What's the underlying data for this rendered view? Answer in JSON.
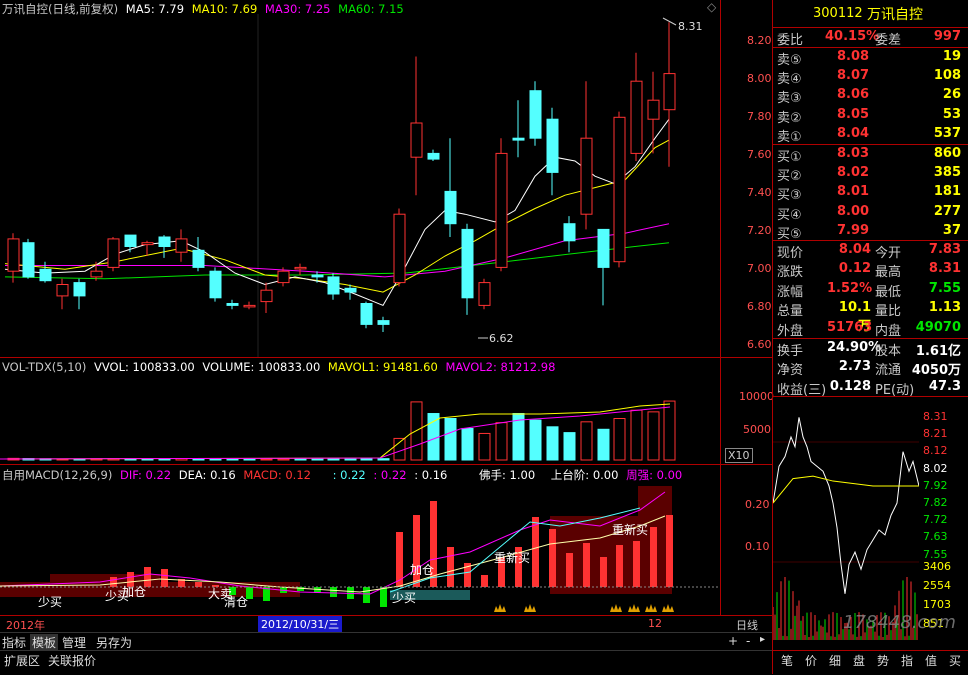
{
  "header": {
    "title": "万讯自控(日线,前复权)",
    "ma5": "MA5: 7.79",
    "ma10": "MA10: 7.69",
    "ma30": "MA30: 7.25",
    "ma60": "MA60: 7.15",
    "high_marker": "8.31",
    "low_marker": "6.62"
  },
  "price_axis": [
    "8.20",
    "8.00",
    "7.80",
    "7.60",
    "7.40",
    "7.20",
    "7.00",
    "6.80",
    "6.60"
  ],
  "volume": {
    "indicator": "VOL-TDX(5,10)",
    "vvol": "VVOL: 100833.00",
    "volume": "VOLUME: 100833.00",
    "mavol1": "MAVOL1: 91481.60",
    "mavol2": "MAVOL2: 81212.98",
    "axis": [
      "10000",
      "5000"
    ],
    "multiplier": "X10"
  },
  "macd": {
    "title": "自用MACD(12,26,9)",
    "dif": "DIF: 0.22",
    "dea": "DEA: 0.16",
    "macd": "MACD: 0.12",
    "v1": ": 0.22",
    ": 0.22": "",
    "v2": ": 0.22",
    "v3": ": 0.16",
    "fushou": "佛手: 1.00",
    "shangtaijie": "上台阶: 0.00",
    "zhouqiang": "周强: 0.00",
    "axis": [
      "0.20",
      "0.10"
    ],
    "labels": [
      "少买",
      "少买",
      "加仓",
      "大卖",
      "清仓",
      "少买",
      "加仓",
      "重新买",
      "重新买"
    ]
  },
  "timeline": {
    "year": "2012年",
    "date": "2012/10/31/三",
    "month": "12",
    "period": "日线"
  },
  "tabs": [
    "指标",
    "模板",
    "管理",
    "另存为"
  ],
  "tabs2": [
    "扩展区",
    "关联报价"
  ],
  "scroll": {
    "plus": "+",
    "minus": "-"
  },
  "stock": {
    "code": "300112",
    "name": "万讯自控"
  },
  "order_book": {
    "wei_bi_label": "委比",
    "wei_bi": "40.15%",
    "wei_cha_label": "委差",
    "wei_cha": "997",
    "asks": [
      {
        "label": "卖⑤",
        "price": "8.08",
        "vol": "19"
      },
      {
        "label": "卖④",
        "price": "8.07",
        "vol": "108"
      },
      {
        "label": "卖③",
        "price": "8.06",
        "vol": "26"
      },
      {
        "label": "卖②",
        "price": "8.05",
        "vol": "53"
      },
      {
        "label": "卖①",
        "price": "8.04",
        "vol": "537"
      }
    ],
    "bids": [
      {
        "label": "买①",
        "price": "8.03",
        "vol": "860"
      },
      {
        "label": "买②",
        "price": "8.02",
        "vol": "385"
      },
      {
        "label": "买③",
        "price": "8.01",
        "vol": "181"
      },
      {
        "label": "买④",
        "price": "8.00",
        "vol": "277"
      },
      {
        "label": "买⑤",
        "price": "7.99",
        "vol": "37"
      }
    ]
  },
  "stats": [
    {
      "l1": "现价",
      "v1": "8.04",
      "l2": "今开",
      "v2": "7.83"
    },
    {
      "l1": "涨跌",
      "v1": "0.12",
      "l2": "最高",
      "v2": "8.31"
    },
    {
      "l1": "涨幅",
      "v1": "1.52%",
      "l2": "最低",
      "v2": "7.55"
    },
    {
      "l1": "总量",
      "v1": "10.1万",
      "l2": "量比",
      "v2": "1.13"
    },
    {
      "l1": "外盘",
      "v1": "51763",
      "l2": "内盘",
      "v2": "49070"
    }
  ],
  "stats2": [
    {
      "l1": "换手",
      "v1": "24.90%",
      "l2": "股本",
      "v2": "1.61亿"
    },
    {
      "l1": "净资",
      "v1": "2.73",
      "l2": "流通",
      "v2": "4050万"
    },
    {
      "l1": "收益(三)",
      "v1": "0.128",
      "l2": "PE(动)",
      "v2": "47.3"
    }
  ],
  "mini_axis": [
    "8.31",
    "8.21",
    "8.12",
    "8.02",
    "7.92",
    "7.82",
    "7.72",
    "7.63",
    "7.55"
  ],
  "mini_vol_axis": [
    "3406",
    "2554",
    "1703",
    "851"
  ],
  "watermark": "178448.com",
  "bottom_tabs": [
    "笔",
    "价",
    "细",
    "盘",
    "势",
    "指",
    "值",
    "买"
  ],
  "colors": {
    "up": "#ff3232",
    "down": "#54ffff",
    "ma5": "#ffffff",
    "ma10": "#ffff00",
    "ma30": "#ff00ff",
    "ma60": "#00e600",
    "border": "#b00000"
  }
}
